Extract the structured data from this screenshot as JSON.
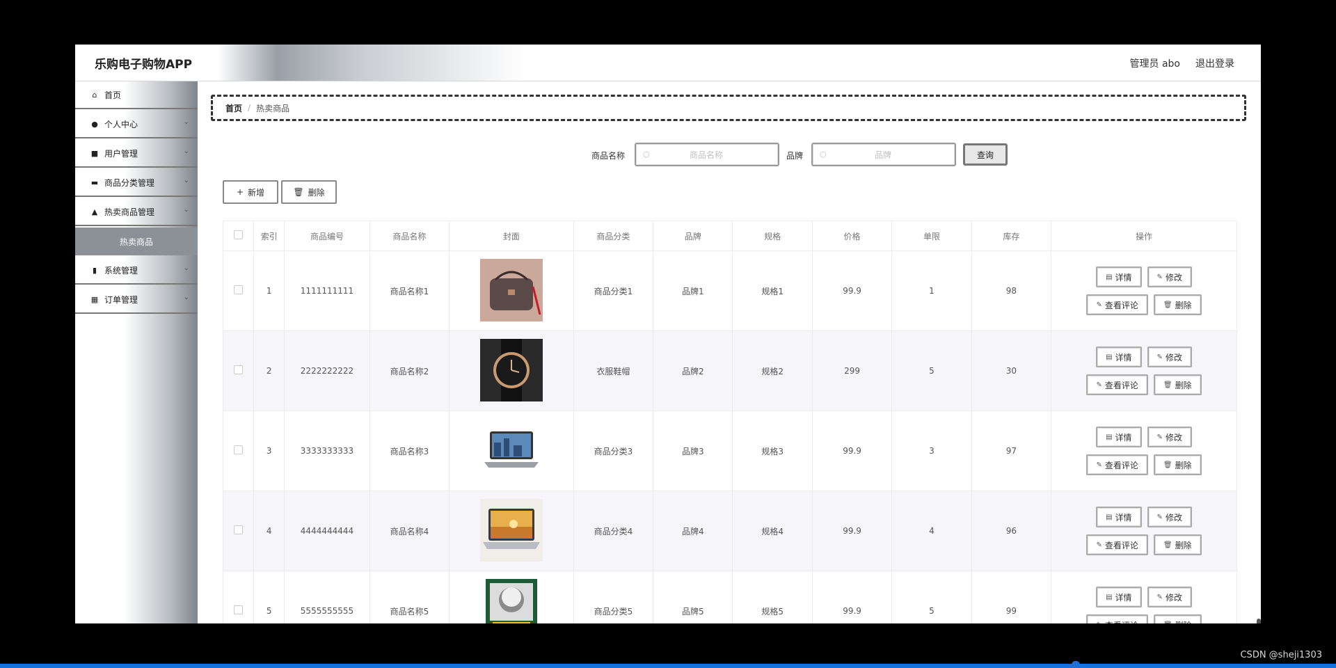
{
  "app": {
    "title": "乐购电子购物APP",
    "user": "管理员 abo",
    "logout": "退出登录"
  },
  "sidebar": {
    "items": [
      {
        "label": "首页",
        "icon": "home-icon",
        "expandable": false
      },
      {
        "label": "个人中心",
        "icon": "user-icon",
        "expandable": true
      },
      {
        "label": "用户管理",
        "icon": "chat-icon",
        "expandable": true
      },
      {
        "label": "商品分类管理",
        "icon": "monitor-icon",
        "expandable": true
      },
      {
        "label": "热卖商品管理",
        "icon": "person-icon",
        "expandable": true
      },
      {
        "label": "热卖商品",
        "sub": true
      },
      {
        "label": "系统管理",
        "icon": "chart-icon",
        "expandable": true
      },
      {
        "label": "订单管理",
        "icon": "grid-icon",
        "expandable": true
      }
    ]
  },
  "breadcrumb": {
    "home": "首页",
    "sep": "/",
    "current": "热卖商品"
  },
  "search": {
    "name_label": "商品名称",
    "name_placeholder": "商品名称",
    "brand_label": "品牌",
    "brand_placeholder": "品牌",
    "query_label": "查询"
  },
  "toolbar": {
    "add_label": "新增",
    "delete_label": "删除"
  },
  "table": {
    "headers": [
      "",
      "索引",
      "商品编号",
      "商品名称",
      "封面",
      "商品分类",
      "品牌",
      "规格",
      "价格",
      "单限",
      "库存",
      "操作"
    ],
    "rows": [
      {
        "index": "1",
        "code": "1111111111",
        "name": "商品名称1",
        "cover": "bag",
        "category": "商品分类1",
        "brand": "品牌1",
        "spec": "规格1",
        "price": "99.9",
        "limit": "1",
        "stock": "98"
      },
      {
        "index": "2",
        "code": "2222222222",
        "name": "商品名称2",
        "cover": "watch",
        "category": "衣服鞋帽",
        "brand": "品牌2",
        "spec": "规格2",
        "price": "299",
        "limit": "5",
        "stock": "30"
      },
      {
        "index": "3",
        "code": "3333333333",
        "name": "商品名称3",
        "cover": "laptop",
        "category": "商品分类3",
        "brand": "品牌3",
        "spec": "规格3",
        "price": "99.9",
        "limit": "3",
        "stock": "97"
      },
      {
        "index": "4",
        "code": "4444444444",
        "name": "商品名称4",
        "cover": "laptop-sunset",
        "category": "商品分类4",
        "brand": "品牌4",
        "spec": "规格4",
        "price": "99.9",
        "limit": "4",
        "stock": "96"
      },
      {
        "index": "5",
        "code": "5555555555",
        "name": "商品名称5",
        "cover": "book",
        "category": "商品分类5",
        "brand": "品牌5",
        "spec": "规格5",
        "price": "99.9",
        "limit": "5",
        "stock": "99"
      }
    ],
    "ops": {
      "detail": "详情",
      "edit": "修改",
      "comments": "查看评论",
      "delete": "删除"
    }
  },
  "watermark": "CSDN @sheji1303",
  "colors": {
    "accent": "#1e6fd9",
    "sidebar_active": "#8c9197"
  }
}
